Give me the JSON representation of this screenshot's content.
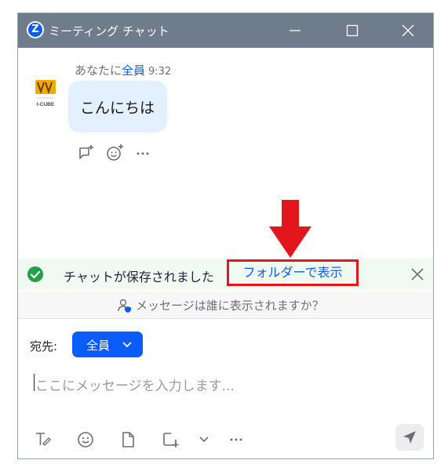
{
  "window": {
    "title": "ミーティング チャット",
    "logo_letter": "Z"
  },
  "message": {
    "sender_prefix": "あなたに",
    "recipient": "全員",
    "time": "9:32",
    "text": "こんにちは",
    "avatar_text": "I-CUBE"
  },
  "notice": {
    "saved_text": "チャットが保存されました",
    "folder_link": "フォルダーで表示"
  },
  "visibility": {
    "text": "メッセージは誰に表示されますか？"
  },
  "composer": {
    "to_label": "宛先:",
    "to_value": "全員",
    "placeholder": "ここにメッセージを入力します..."
  },
  "colors": {
    "accent": "#0b5cff",
    "highlight": "#e3161d",
    "success": "#24a148"
  }
}
